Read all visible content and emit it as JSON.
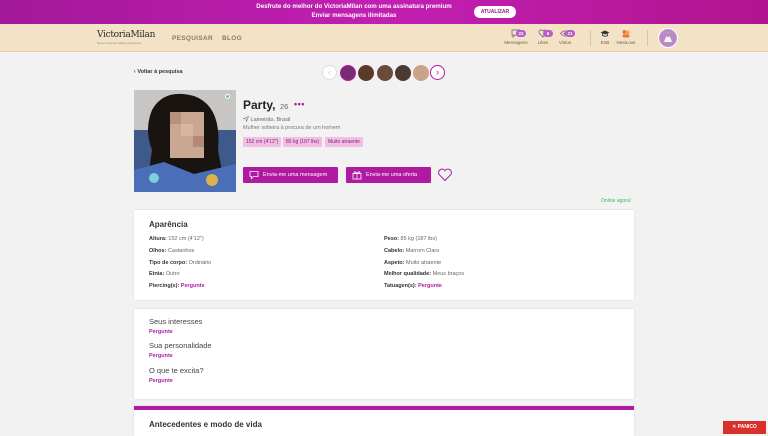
{
  "promo": {
    "line1": "Desfrute do melhor do VictoriaMilan com uma assinatura premium",
    "line2": "Enviar mensagens ilimitadas",
    "button": "ATUALIZAR",
    "color": "#b01aa0"
  },
  "header": {
    "logo": "VictoriaMilan",
    "logo_tagline": "Never a secret, always a discreet",
    "nav": [
      "PESQUISAR",
      "BLOG"
    ],
    "icons": [
      {
        "icon": "message-icon",
        "label": "Mensagens",
        "count": "22"
      },
      {
        "icon": "heart-icon",
        "label": "Likes",
        "count": "5"
      },
      {
        "icon": "eye-icon",
        "label": "Vistos",
        "count": "21"
      },
      {
        "icon": "graduation-cap-icon",
        "label": "EnB",
        "count": ""
      },
      {
        "icon": "couple-icon",
        "label": "NestLove",
        "count": ""
      }
    ]
  },
  "back_link": "Voltar à pesquisa",
  "profile": {
    "name": "Party,",
    "age": "26",
    "location": "Lameirão, Brasil",
    "seeking": "Mulher solteira à procura de um homem",
    "tags": [
      "152 cm (4'12\")",
      "85 kg (187 lbs)",
      "Muito atraente"
    ],
    "message_button": "Envia-me uma mensagem",
    "offer_button": "Envia-me uma oferta",
    "online_status": "Online agora!"
  },
  "aparencia": {
    "title": "Aparência",
    "left": [
      {
        "label": "Altura:",
        "value": "152 cm (4'12\")",
        "ask": false
      },
      {
        "label": "Olhos:",
        "value": "Castanhos",
        "ask": false
      },
      {
        "label": "Tipo de corpo:",
        "value": "Ordinário",
        "ask": false
      },
      {
        "label": "Etnia:",
        "value": "Outro",
        "ask": false
      },
      {
        "label": "Piercing(s):",
        "value": "Pergunte",
        "ask": true
      }
    ],
    "right": [
      {
        "label": "Peso:",
        "value": "85 kg (187 lbs)",
        "ask": false
      },
      {
        "label": "Cabelo:",
        "value": "Marrom Claro",
        "ask": false
      },
      {
        "label": "Aspeto:",
        "value": "Muito atraente",
        "ask": false
      },
      {
        "label": "Melhor qualidade:",
        "value": "Meus braços",
        "ask": false
      },
      {
        "label": "Tatuagen(s):",
        "value": "Pergunte",
        "ask": true
      }
    ]
  },
  "interesses": [
    {
      "title": "Seus interesses",
      "answer": "Pergunte"
    },
    {
      "title": "Sua personalidade",
      "answer": "Pergunte"
    },
    {
      "title": "O que te excita?",
      "answer": "Pergunte"
    }
  ],
  "background_title": "Antecedentes e modo de vida",
  "panic_button": "PANICO"
}
